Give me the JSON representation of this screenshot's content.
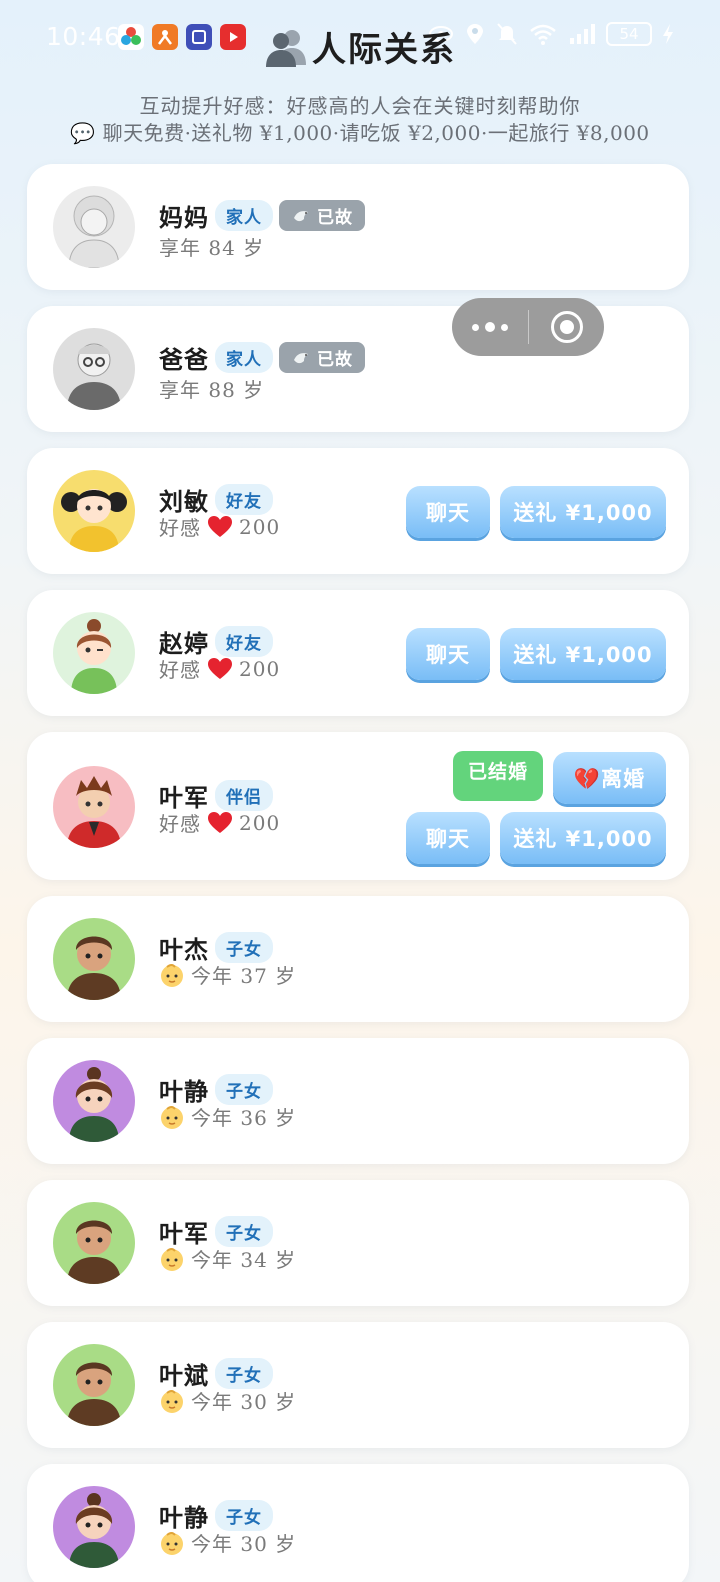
{
  "status_bar": {
    "time": "10:46",
    "battery": "54"
  },
  "header": {
    "title": "人际关系",
    "subtitle": "互动提升好感：好感高的人会在关键时刻帮助你",
    "prices": "💬 聊天免费·送礼物 ¥1,000·请吃饭 ¥2,000·一起旅行 ¥8,000"
  },
  "contacts": [
    {
      "name": "妈妈",
      "tag": "家人",
      "status": "已故",
      "info": "享年 84 岁"
    },
    {
      "name": "爸爸",
      "tag": "家人",
      "status": "已故",
      "info": "享年 88 岁"
    },
    {
      "name": "刘敏",
      "tag": "好友",
      "affection_label": "好感",
      "affection": "200",
      "chat": "聊天",
      "gift": "送礼 ¥1,000"
    },
    {
      "name": "赵婷",
      "tag": "好友",
      "affection_label": "好感",
      "affection": "200",
      "chat": "聊天",
      "gift": "送礼 ¥1,000"
    },
    {
      "name": "叶军",
      "tag": "伴侣",
      "affection_label": "好感",
      "affection": "200",
      "married": "已结婚",
      "divorce": "💔离婚",
      "chat": "聊天",
      "gift": "送礼 ¥1,000"
    },
    {
      "name": "叶杰",
      "tag": "子女",
      "info": "今年 37 岁"
    },
    {
      "name": "叶静",
      "tag": "子女",
      "info": "今年 36 岁"
    },
    {
      "name": "叶军",
      "tag": "子女",
      "info": "今年 34 岁"
    },
    {
      "name": "叶斌",
      "tag": "子女",
      "info": "今年 30 岁"
    },
    {
      "name": "叶静",
      "tag": "子女",
      "info": "今年 30 岁"
    }
  ],
  "colors": {
    "accent": "#79bdf6",
    "tag_text": "#2170b8",
    "married": "#63d47c",
    "deceased": "#9aa3ab"
  },
  "icons": [
    "people-silhouette-icon",
    "speech-bubble-icon",
    "dove-icon",
    "heart-icon",
    "baby-icon",
    "broken-heart-icon",
    "more-dots-icon",
    "target-icon",
    "wifi-icon",
    "signal-icon",
    "battery-icon"
  ]
}
